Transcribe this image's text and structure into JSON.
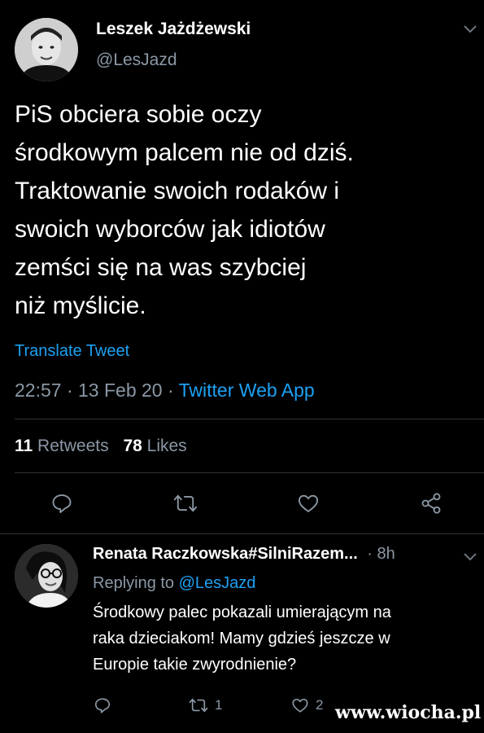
{
  "tweet": {
    "author_name": "Leszek Jażdżewski",
    "author_handle": "@LesJazd",
    "text_lines": [
      "PiS obciera sobie oczy",
      "środkowym palcem nie od dziś.",
      "Traktowanie swoich rodaków i",
      "swoich wyborców jak idiotów",
      "zemści się na was szybciej",
      "niż myślicie."
    ],
    "translate_label": "Translate Tweet",
    "time": "22:57",
    "sep1": "·",
    "date": "13 Feb 20",
    "sep2": "·",
    "source": "Twitter Web App",
    "retweets_count": "11",
    "retweets_label": "Retweets",
    "likes_count": "78",
    "likes_label": "Likes"
  },
  "reply": {
    "author_name": "Renata Raczkowska#SilniRazem...",
    "time_sep": "·",
    "time": "8h",
    "replying_prefix": "Replying to",
    "replying_handle": "@LesJazd",
    "text_lines": [
      "Środkowy palec pokazali umierającym na",
      "raka dzieciakom! Mamy gdzieś jeszcze w",
      "Europie takie zwyrodnienie?"
    ],
    "retweet_count": "1",
    "like_count": "2"
  },
  "watermark": "www.wiocha.pl",
  "colors": {
    "background": "#000000",
    "text": "#ffffff",
    "secondary": "#8b98a5",
    "link": "#1da1f2",
    "divider": "#2f3336"
  },
  "icons": {
    "reply": "reply-icon",
    "retweet": "retweet-icon",
    "like": "heart-icon",
    "share": "share-icon",
    "menu": "chevron-down-icon"
  }
}
